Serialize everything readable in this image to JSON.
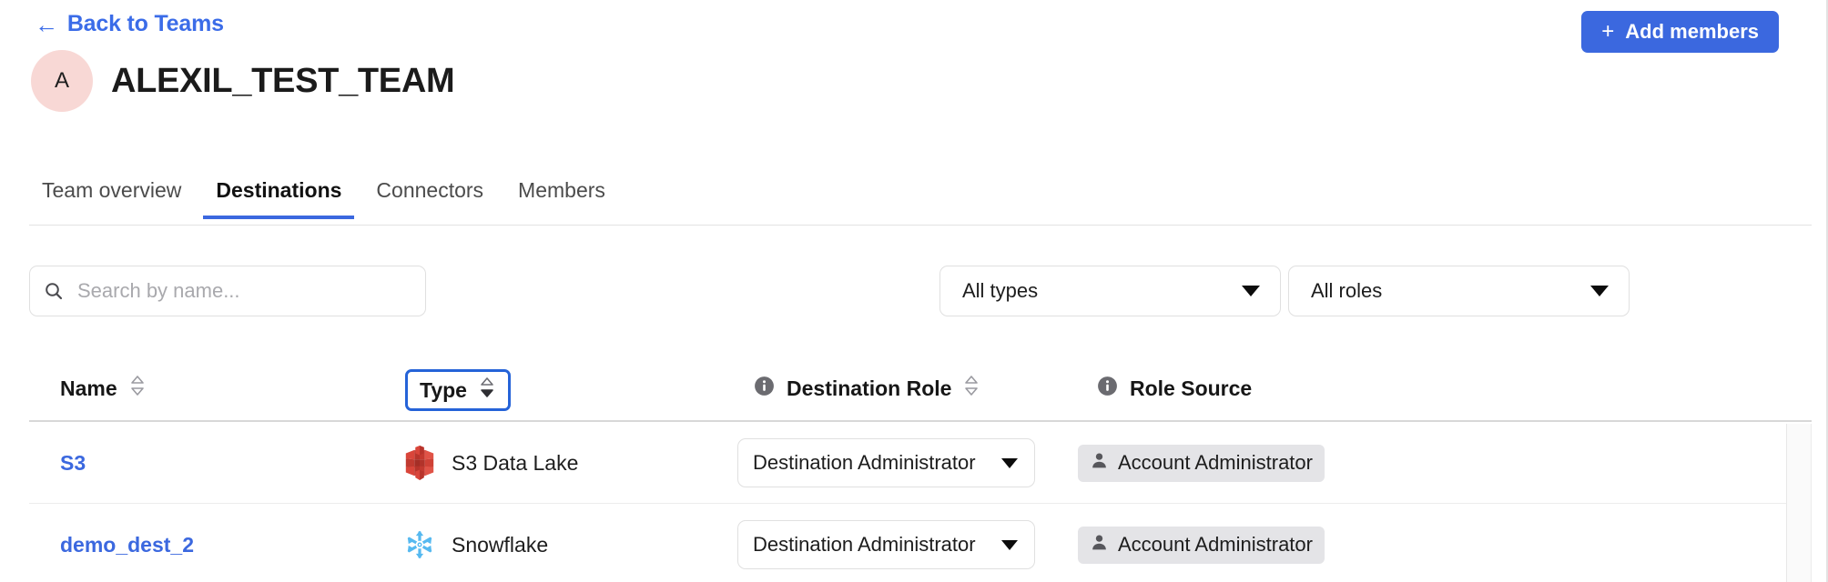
{
  "header": {
    "back_link": "Back to Teams",
    "back_arrow_icon": "arrow-left-icon",
    "add_members_label": "Add members",
    "add_members_plus_icon": "plus-icon",
    "accent_color": "#3b68df"
  },
  "team": {
    "avatar_initial": "A",
    "avatar_color": "#f8d8d5",
    "name": "ALEXIL_TEST_TEAM"
  },
  "tabs": [
    {
      "label": "Team overview",
      "active": false
    },
    {
      "label": "Destinations",
      "active": true
    },
    {
      "label": "Connectors",
      "active": false
    },
    {
      "label": "Members",
      "active": false
    }
  ],
  "filters": {
    "search_placeholder": "Search by name...",
    "search_value": "",
    "search_icon": "search-icon",
    "type_filter": "All types",
    "role_filter": "All roles",
    "caret_icon": "chevron-down-icon"
  },
  "table": {
    "columns": [
      {
        "label": "Name",
        "sortable": true,
        "info": false
      },
      {
        "label": "Type",
        "sortable": true,
        "info": false,
        "focused": true
      },
      {
        "label": "Destination Role",
        "sortable": true,
        "info": true
      },
      {
        "label": "Role Source",
        "sortable": false,
        "info": true
      }
    ],
    "rows": [
      {
        "name": "S3",
        "type_icon": "aws-s3-icon",
        "type": "S3 Data Lake",
        "destination_role": "Destination Administrator",
        "role_source": "Account Administrator",
        "role_source_icon": "person-icon"
      },
      {
        "name": "demo_dest_2",
        "type_icon": "snowflake-icon",
        "type": "Snowflake",
        "destination_role": "Destination Administrator",
        "role_source": "Account Administrator",
        "role_source_icon": "person-icon"
      }
    ]
  }
}
